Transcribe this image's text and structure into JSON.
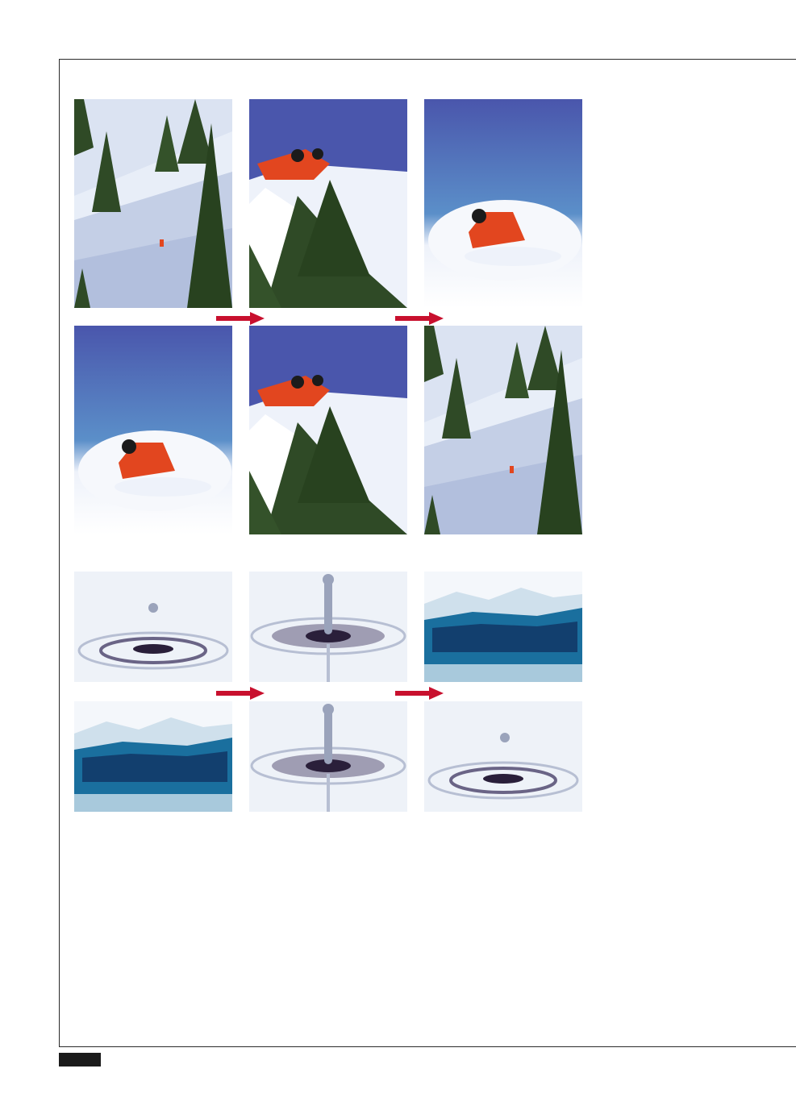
{
  "colors": {
    "sky": "#4a56ac",
    "snow": "#f2f5fb",
    "tree": "#2f4a26",
    "jacket": "#e2461f",
    "arrow": "#c8102e",
    "water": "#1a6f9e",
    "ink": "#2a1f3a"
  },
  "panels": {
    "ski_sequence": [
      "ski-landscape",
      "ski-jump",
      "ski-powder",
      "ski-powder",
      "ski-jump",
      "ski-landscape"
    ],
    "drop_sequence": [
      "drop-falling",
      "drop-column",
      "drop-crown",
      "drop-crown",
      "drop-column",
      "drop-falling"
    ]
  },
  "icons": [
    "arrow-right-icon"
  ]
}
